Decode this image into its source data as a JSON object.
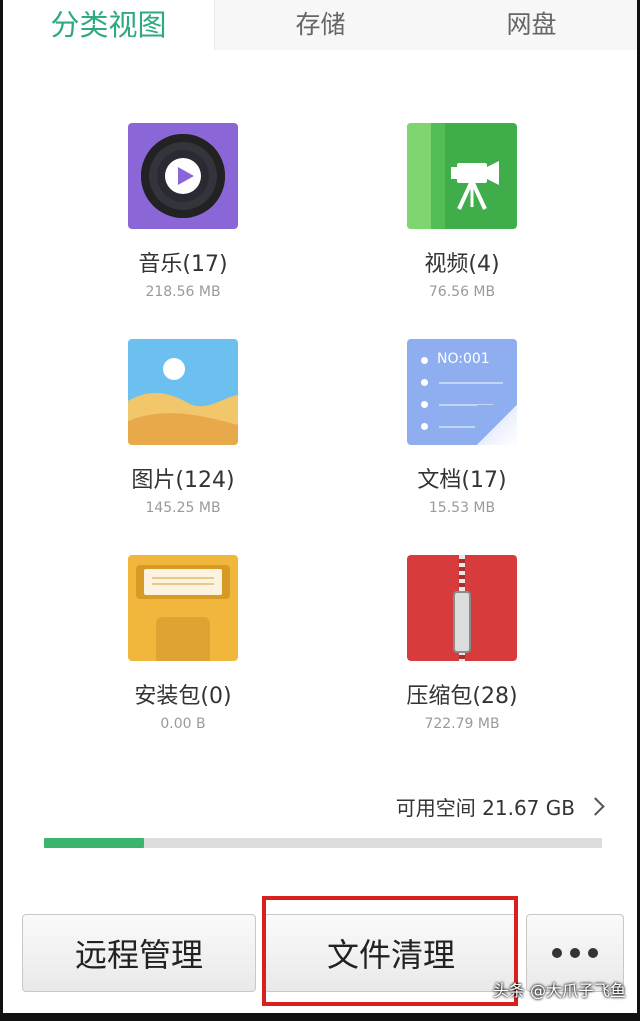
{
  "tabs": [
    {
      "label": "分类视图",
      "active": true
    },
    {
      "label": "存储",
      "active": false
    },
    {
      "label": "网盘",
      "active": false
    }
  ],
  "categories": [
    {
      "label": "音乐(17)",
      "size": "218.56 MB",
      "icon": "music-disc-icon",
      "color": "#8b66d6"
    },
    {
      "label": "视频(4)",
      "size": "76.56 MB",
      "icon": "video-camera-icon",
      "color": "#3fae4a"
    },
    {
      "label": "图片(124)",
      "size": "145.25 MB",
      "icon": "landscape-image-icon",
      "color": "#6cc0ef"
    },
    {
      "label": "文档(17)",
      "size": "15.53 MB",
      "icon": "document-list-icon",
      "color": "#8eaef0",
      "icon_text": "NO:001"
    },
    {
      "label": "安装包(0)",
      "size": "0.00 B",
      "icon": "android-package-icon",
      "color": "#f0b73c"
    },
    {
      "label": "压缩包(28)",
      "size": "722.79 MB",
      "icon": "zip-archive-icon",
      "color": "#d73b3b"
    }
  ],
  "storage": {
    "available_label": "可用空间 21.67 GB",
    "used_fraction": 0.18,
    "bar_color": "#3bb56b"
  },
  "bottom_buttons": {
    "remote": "远程管理",
    "clean": "文件清理",
    "more_icon": "more-dots-icon"
  },
  "highlight_color": "#d8201f",
  "watermark": "头条 @大爪子飞鱼",
  "accent_color": "#2eaa7e"
}
